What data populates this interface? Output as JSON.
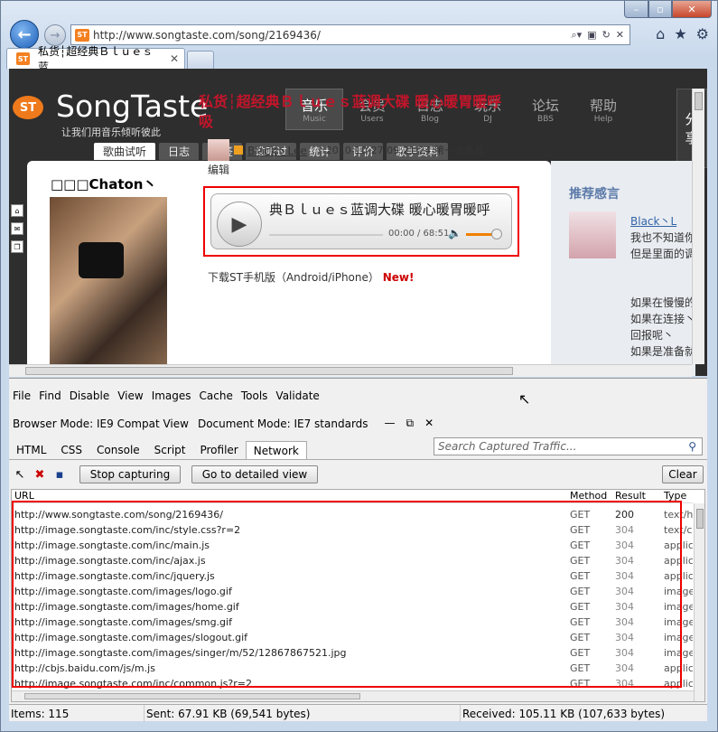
{
  "browser": {
    "address": "http://www.songtaste.com/song/2169436/",
    "tab_title": "私货┆超经典Ｂｌｕｅｓ蓝...",
    "favicon": "ST"
  },
  "site": {
    "name": "SongTaste",
    "slogan": "让我们用音乐倾听彼此",
    "logo_text": "ST",
    "nav": [
      {
        "cn": "音乐",
        "en": "Music"
      },
      {
        "cn": "会员",
        "en": "Users"
      },
      {
        "cn": "日志",
        "en": "Blog"
      },
      {
        "cn": "玩乐",
        "en": "DJ"
      },
      {
        "cn": "论坛",
        "en": "BBS"
      },
      {
        "cn": "帮助",
        "en": "Help"
      }
    ],
    "share": [
      "分",
      "享"
    ],
    "subtabs": [
      "歌曲试听",
      "日志",
      "标签",
      "谁听过",
      "统计",
      "评价",
      "歌手资料"
    ],
    "user": "□□□Chaton丶",
    "song_title": "私货┆超经典Ｂｌｕｅｓ蓝调大碟 暖心暖胃暖呼吸",
    "poster": "Black丶Lee",
    "post_date": "2010-10-27 09:21:24 第一次推荐",
    "edit": "编辑",
    "player_title": "典Ｂｌｕｅｓ蓝调大碟 暖心暖胃暖呼",
    "player_time": "00:00 / 68:51",
    "download": "下载ST手机版（Android/iPhone）",
    "download_new": "New!",
    "side_heading": "推荐感言",
    "side_user": "Black丶L",
    "side_text": "我也不知道你\n但是里面的调\n\n\n如果在慢慢的\n如果在连接丶\n回报呢丶\n如果是准备就"
  },
  "devtools": {
    "menu": [
      "File",
      "Find",
      "Disable",
      "View",
      "Images",
      "Cache",
      "Tools",
      "Validate"
    ],
    "browser_mode": "Browser Mode: IE9 Compat View",
    "document_mode": "Document Mode: IE7 standards",
    "tabs": [
      "HTML",
      "CSS",
      "Console",
      "Script",
      "Profiler",
      "Network"
    ],
    "search_placeholder": "Search Captured Traffic...",
    "stop_label": "Stop capturing",
    "detail_label": "Go to detailed view",
    "clear_label": "Clear",
    "columns": {
      "url": "URL",
      "method": "Method",
      "result": "Result",
      "type": "Type"
    },
    "rows": [
      {
        "url": "http://www.songtaste.com/song/2169436/",
        "method": "GET",
        "result": "200",
        "type": "text/h"
      },
      {
        "url": "http://image.songtaste.com/inc/style.css?r=2",
        "method": "GET",
        "result": "304",
        "type": "text/cs"
      },
      {
        "url": "http://image.songtaste.com/inc/main.js",
        "method": "GET",
        "result": "304",
        "type": "applica"
      },
      {
        "url": "http://image.songtaste.com/inc/ajax.js",
        "method": "GET",
        "result": "304",
        "type": "applica"
      },
      {
        "url": "http://image.songtaste.com/inc/jquery.js",
        "method": "GET",
        "result": "304",
        "type": "applica"
      },
      {
        "url": "http://image.songtaste.com/images/logo.gif",
        "method": "GET",
        "result": "304",
        "type": "image/"
      },
      {
        "url": "http://image.songtaste.com/images/home.gif",
        "method": "GET",
        "result": "304",
        "type": "image/"
      },
      {
        "url": "http://image.songtaste.com/images/smg.gif",
        "method": "GET",
        "result": "304",
        "type": "image/"
      },
      {
        "url": "http://image.songtaste.com/images/slogout.gif",
        "method": "GET",
        "result": "304",
        "type": "image/"
      },
      {
        "url": "http://image.songtaste.com/images/singer/m/52/12867867521.jpg",
        "method": "GET",
        "result": "304",
        "type": "image/"
      },
      {
        "url": "http://cbjs.baidu.com/js/m.js",
        "method": "GET",
        "result": "304",
        "type": "applica"
      },
      {
        "url": "http://image.songtaste.com/inc/common.js?r=2",
        "method": "GET",
        "result": "304",
        "type": "applica"
      }
    ],
    "status_items": "Items: 115",
    "status_sent": "Sent: 67.91 KB (69,541 bytes)",
    "status_received": "Received: 105.11 KB (107,633 bytes)"
  }
}
